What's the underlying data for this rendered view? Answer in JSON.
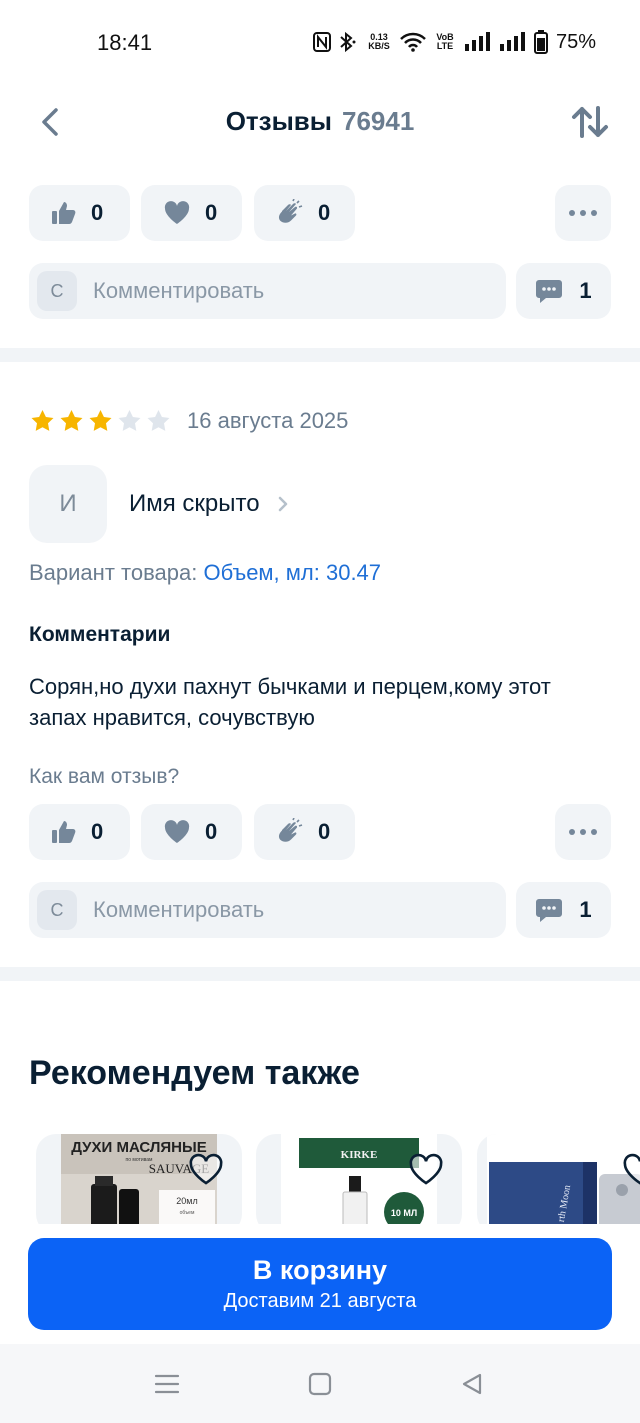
{
  "status_bar": {
    "time": "18:41",
    "net_speed_value": "0.13",
    "net_speed_unit": "KB/S",
    "volte_top": "VoB",
    "volte_bottom": "LTE",
    "battery": "75%"
  },
  "header": {
    "title": "Отзывы",
    "count": "76941"
  },
  "previous_review": {
    "reactions": {
      "like": "0",
      "heart": "0",
      "clap": "0"
    },
    "comment_avatar": "С",
    "comment_placeholder": "Комментировать",
    "comment_count": "1"
  },
  "review": {
    "rating": 3,
    "rating_max": 5,
    "date": "16 августа 2025",
    "author_initial": "И",
    "author_name": "Имя скрыто",
    "variant_label": "Вариант товара:",
    "variant_value": "Объем, мл: 30.47",
    "comments_heading": "Комментарии",
    "text": "Сорян,но духи пахнут бычками и перцем,кому этот запах нравится, сочувствую",
    "question": "Как вам отзыв?",
    "reactions": {
      "like": "0",
      "heart": "0",
      "clap": "0"
    },
    "comment_avatar": "С",
    "comment_placeholder": "Комментировать",
    "comment_count": "1"
  },
  "recommendations": {
    "title": "Рекомендуем также",
    "items": [
      {
        "img_line1": "ДУХИ МАСЛЯНЫЕ",
        "img_line2": "по мотивам",
        "img_line3": "SAUVAGE",
        "img_badge": "20мл",
        "img_badge_sub": "объем"
      },
      {
        "img_label": "KIRKE",
        "img_badge": "10 МЛ"
      },
      {
        "img_label": "rth Moon"
      }
    ]
  },
  "cart": {
    "label": "В корзину",
    "delivery": "Доставим 21 августа"
  },
  "colors": {
    "accent": "#0b63f6",
    "star_filled": "#f7b500",
    "star_empty": "#dfe5ec",
    "surface": "#f1f4f7",
    "link": "#1f6fd6"
  }
}
